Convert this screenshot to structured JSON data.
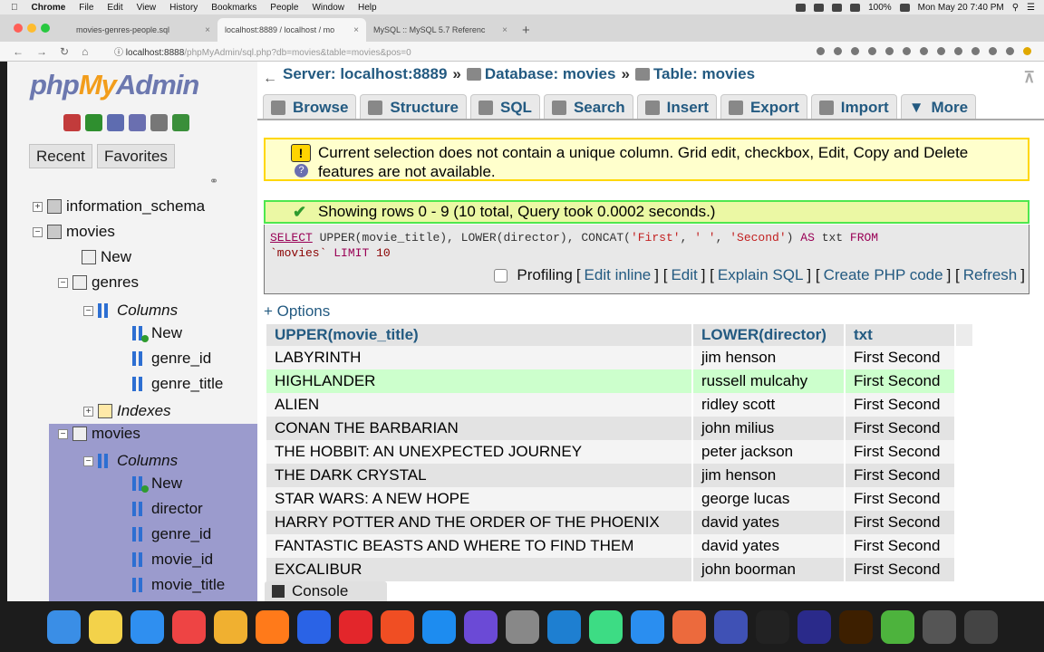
{
  "menubar": {
    "app": "Chrome",
    "items": [
      "File",
      "Edit",
      "View",
      "History",
      "Bookmarks",
      "People",
      "Window",
      "Help"
    ],
    "battery": "100%",
    "datetime": "Mon May 20 7:40 PM"
  },
  "browser": {
    "tabs": [
      {
        "label": "movies-genres-people.sql",
        "close": "×"
      },
      {
        "label": "localhost:8889 / localhost / mo",
        "close": "×"
      },
      {
        "label": "MySQL :: MySQL 5.7 Referenc",
        "close": "×"
      }
    ],
    "new_tab": "+",
    "url_host": "localhost:8888",
    "url_path": "/phpMyAdmin/sql.php?db=movies&table=movies&pos=0"
  },
  "sidebar": {
    "logo_php": "php",
    "logo_my": "My",
    "logo_admin": "Admin",
    "recent_label": "Recent",
    "favorites_label": "Favorites",
    "link_icon": "link-icon",
    "tree": {
      "information_schema": "information_schema",
      "movies_db": "movies",
      "new": "New",
      "genres": "genres",
      "columns": "Columns",
      "col_new": "New",
      "genre_id": "genre_id",
      "genre_title": "genre_title",
      "indexes": "Indexes",
      "movies_table": "movies",
      "columns2": "Columns",
      "col_new2": "New",
      "director": "director",
      "genre_id2": "genre_id",
      "movie_id": "movie_id",
      "movie_title": "movie_title"
    }
  },
  "breadcrumb": {
    "server": "Server: localhost:8889",
    "database": "Database: movies",
    "table": "Table: movies",
    "sep": "»"
  },
  "tabs": [
    "Browse",
    "Structure",
    "SQL",
    "Search",
    "Insert",
    "Export",
    "Import",
    "More"
  ],
  "notice": {
    "line1": "Current selection does not contain a unique column. Grid edit, checkbox, Edit, Copy and Delete",
    "line2": "features are not available."
  },
  "success": "Showing rows 0 - 9 (10 total, Query took 0.0002 seconds.)",
  "sql": {
    "select": "SELECT",
    "f1": "UPPER",
    "a1": "(movie_title),",
    "f2": "LOWER",
    "a2": "(director),",
    "f3": "CONCAT",
    "a3a": "(",
    "s1": "'First'",
    "c1": ",",
    "s2": "' '",
    "c2": ",",
    "s3": "'Second'",
    "a3b": ")",
    "as": "AS",
    "alias": "txt",
    "from": "FROM",
    "table": "`movies`",
    "limit": "LIMIT",
    "num": "10"
  },
  "sql_links": {
    "profiling": "Profiling",
    "edit_inline": "Edit inline",
    "edit": "Edit",
    "explain": "Explain SQL",
    "php": "Create PHP code",
    "refresh": "Refresh"
  },
  "options": "+ Options",
  "table": {
    "headers": [
      "UPPER(movie_title)",
      "LOWER(director)",
      "txt"
    ],
    "rows": [
      [
        "LABYRINTH",
        "jim henson",
        "First Second"
      ],
      [
        "HIGHLANDER",
        "russell mulcahy",
        "First Second"
      ],
      [
        "ALIEN",
        "ridley scott",
        "First Second"
      ],
      [
        "CONAN THE BARBARIAN",
        "john milius",
        "First Second"
      ],
      [
        "THE HOBBIT: AN UNEXPECTED JOURNEY",
        "peter jackson",
        "First Second"
      ],
      [
        "THE DARK CRYSTAL",
        "jim henson",
        "First Second"
      ],
      [
        "STAR WARS: A NEW HOPE",
        "george lucas",
        "First Second"
      ],
      [
        "HARRY POTTER AND THE ORDER OF THE PHOENIX",
        "david yates",
        "First Second"
      ],
      [
        "FANTASTIC BEASTS AND WHERE TO FIND THEM",
        "david yates",
        "First Second"
      ],
      [
        "EXCALIBUR",
        "john boorman",
        "First Second"
      ]
    ]
  },
  "console": "Console",
  "dock_icons": [
    "finder-icon",
    "notes-icon",
    "app-store-icon",
    "chrome-icon",
    "chrome-canary-icon",
    "firefox-icon",
    "firefox-dev-icon",
    "opera-icon",
    "brave-icon",
    "safari-icon",
    "safari-preview-icon",
    "mysql-workbench-icon",
    "vscode-icon",
    "android-studio-icon",
    "xcode-icon",
    "paw-icon",
    "night-mode-icon",
    "terminal-icon",
    "photoshop-icon",
    "illustrator-icon",
    "mongodb-icon",
    "tableplus-icon",
    "trash-icon"
  ],
  "colors": {
    "link": "#235a81",
    "notice_border": "#ffd700",
    "success_border": "#4ee74e",
    "highlight_row": "#ccffcc",
    "selected_tree": "#9b9bcd"
  }
}
